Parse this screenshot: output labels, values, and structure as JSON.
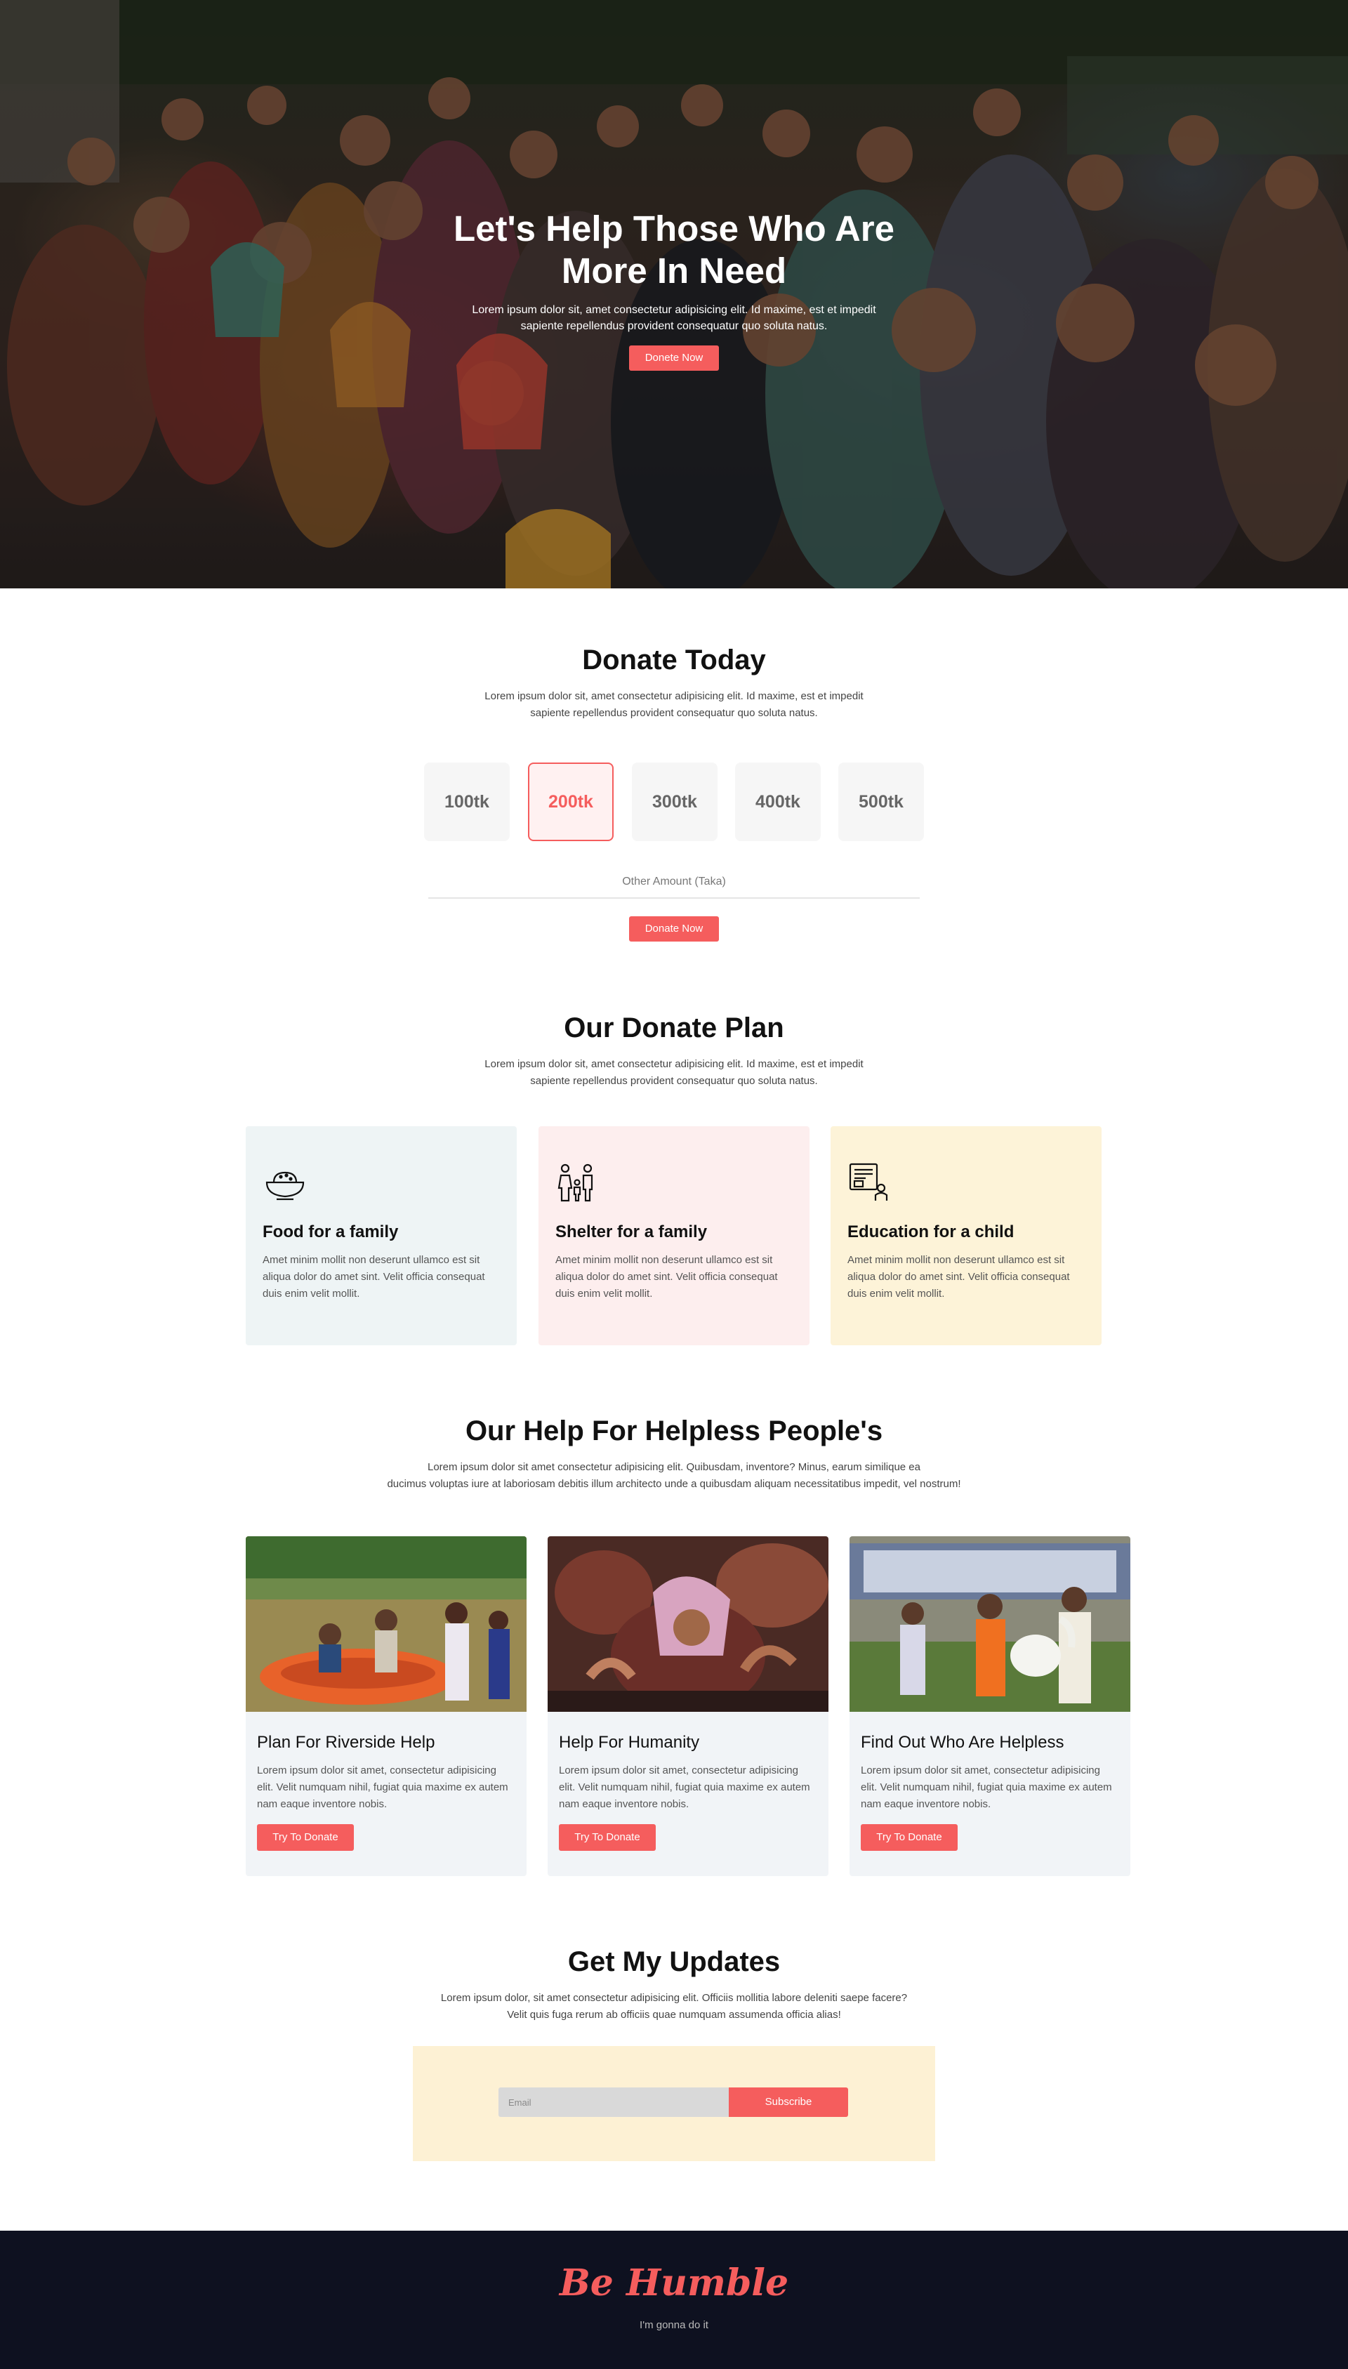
{
  "hero": {
    "title_line1": "Let's Help Those Who Are",
    "title_line2": "More In Need",
    "text": "Lorem ipsum dolor sit, amet consectetur adipisicing elit. Id maxime, est et impedit sapiente repellendus provident consequatur quo soluta natus.",
    "button": "Donete Now"
  },
  "donate_today": {
    "title": "Donate Today",
    "text": "Lorem ipsum dolor sit, amet consectetur adipisicing elit. Id maxime, est et impedit sapiente repellendus provident consequatur quo soluta natus.",
    "amounts": [
      "100tk",
      "200tk",
      "300tk",
      "400tk",
      "500tk"
    ],
    "selected": "200tk",
    "other_placeholder": "Other Amount (Taka)",
    "button": "Donate Now"
  },
  "plans": {
    "title": "Our Donate Plan",
    "text": "Lorem ipsum dolor sit, amet consectetur adipisicing elit. Id maxime, est et impedit sapiente repellendus provident consequatur quo soluta natus.",
    "items": [
      {
        "icon": "food-bowl-icon",
        "title": "Food for a family",
        "text": "Amet minim mollit non deserunt ullamco est sit aliqua dolor do amet sint. Velit officia consequat duis enim velit mollit.",
        "color": "#eef4f5"
      },
      {
        "icon": "family-icon",
        "title": "Shelter for a family",
        "text": "Amet minim mollit non deserunt ullamco est sit aliqua dolor do amet sint. Velit officia consequat duis enim velit mollit.",
        "color": "#fdeeee"
      },
      {
        "icon": "education-board-icon",
        "title": "Education for a child",
        "text": "Amet minim mollit non deserunt ullamco est sit aliqua dolor do amet sint. Velit officia consequat duis enim velit mollit.",
        "color": "#fdf3d8"
      }
    ]
  },
  "help": {
    "title": "Our Help For Helpless People's",
    "text_line1": "Lorem ipsum dolor sit amet consectetur adipisicing elit. Quibusdam, inventore? Minus, earum similique ea",
    "text_line2": "ducimus voluptas iure at laboriosam debitis illum architecto unde a quibusdam aliquam necessitatibus impedit, vel nostrum!",
    "cards": [
      {
        "title": "Plan For Riverside Help",
        "text": "Lorem ipsum dolor sit amet, consectetur adipisicing elit. Velit numquam nihil, fugiat quia maxime ex autem nam eaque inventore nobis.",
        "button": "Try To Donate"
      },
      {
        "title": "Help For Humanity",
        "text": "Lorem ipsum dolor sit amet, consectetur adipisicing elit. Velit numquam nihil, fugiat quia maxime ex autem nam eaque inventore nobis.",
        "button": "Try To Donate"
      },
      {
        "title": "Find Out Who Are Helpless",
        "text": "Lorem ipsum dolor sit amet, consectetur adipisicing elit. Velit numquam nihil, fugiat quia maxime ex autem nam eaque inventore nobis.",
        "button": "Try To Donate"
      }
    ]
  },
  "updates": {
    "title": "Get My Updates",
    "text_line1": "Lorem ipsum dolor, sit amet consectetur adipisicing elit. Officiis mollitia labore deleniti saepe facere?",
    "text_line2": "Velit quis fuga rerum ab officiis quae numquam assumenda officia alias!",
    "email_placeholder": "Email",
    "button": "Subscribe"
  },
  "footer": {
    "logo": "Be Humble",
    "tagline": "I'm gonna do it"
  },
  "colors": {
    "accent": "#f55d5d",
    "footer_bg": "#0e1120",
    "update_bg": "#fdf1d4"
  }
}
